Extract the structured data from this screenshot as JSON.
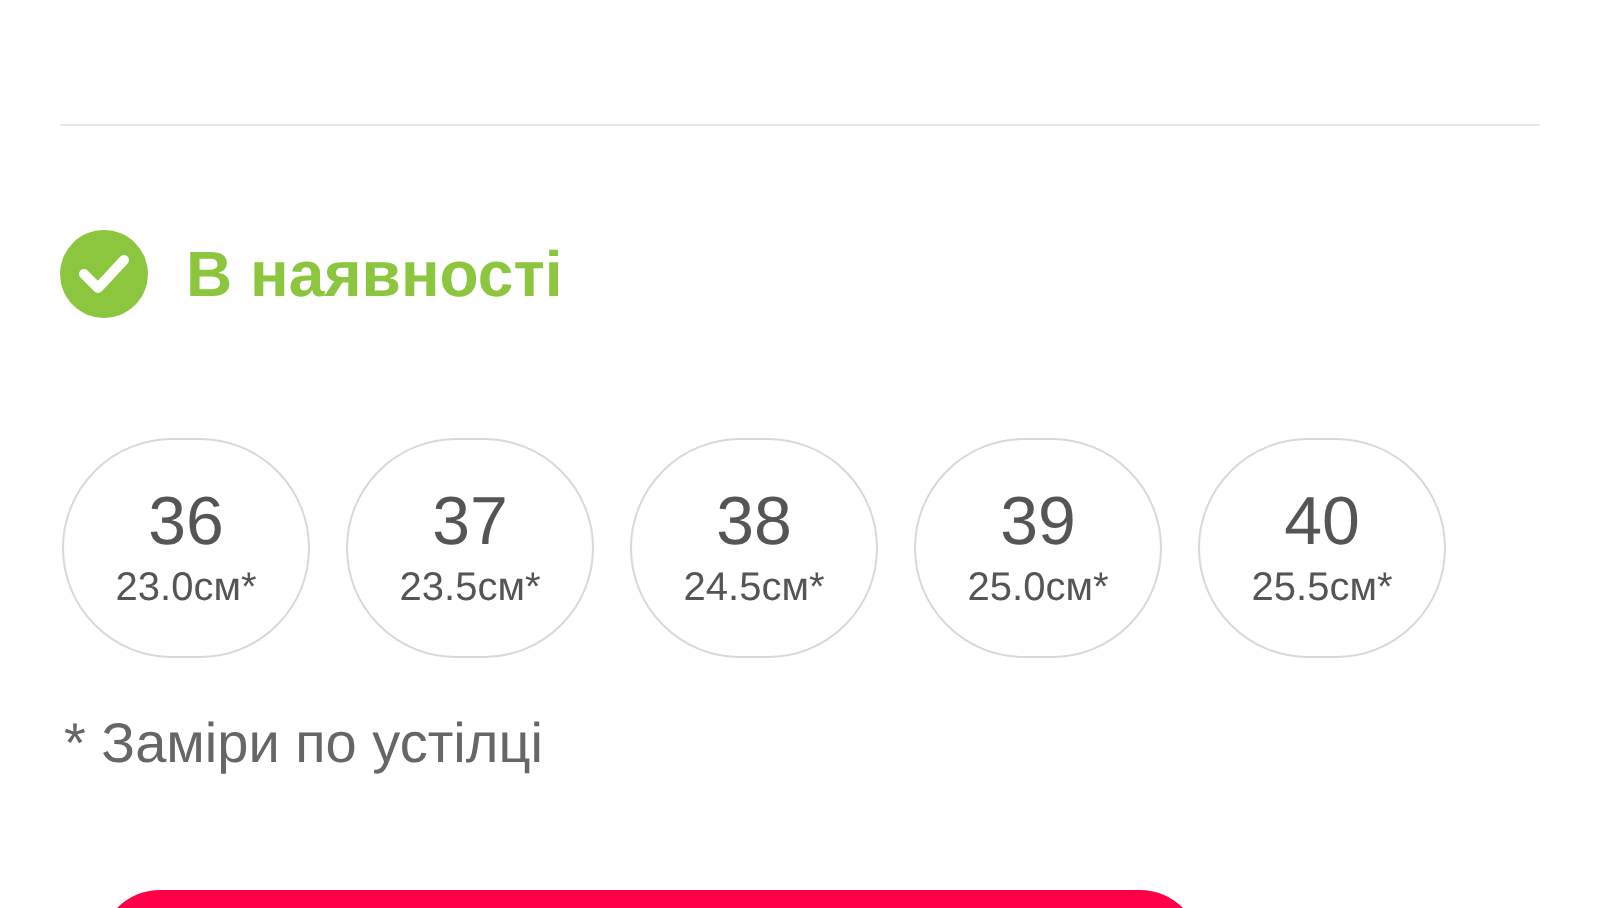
{
  "availability": {
    "in_stock": true,
    "label": "В наявності"
  },
  "sizes": [
    {
      "size": "36",
      "length": "23.0см*",
      "selected": false
    },
    {
      "size": "37",
      "length": "23.5см*",
      "selected": false
    },
    {
      "size": "38",
      "length": "24.5см*",
      "selected": false
    },
    {
      "size": "39",
      "length": "25.0см*",
      "selected": false
    },
    {
      "size": "40",
      "length": "25.5см*",
      "selected": false
    }
  ],
  "note": "* Заміри по устілці"
}
